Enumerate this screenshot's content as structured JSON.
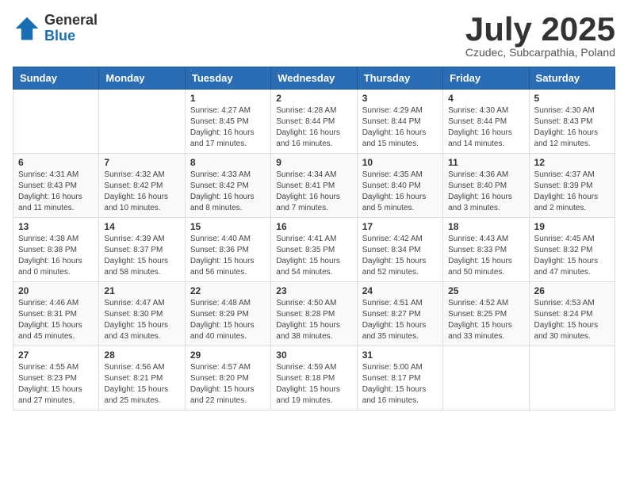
{
  "header": {
    "logo_general": "General",
    "logo_blue": "Blue",
    "month_title": "July 2025",
    "location": "Czudec, Subcarpathia, Poland"
  },
  "days_of_week": [
    "Sunday",
    "Monday",
    "Tuesday",
    "Wednesday",
    "Thursday",
    "Friday",
    "Saturday"
  ],
  "weeks": [
    [
      {
        "day": "",
        "info": ""
      },
      {
        "day": "",
        "info": ""
      },
      {
        "day": "1",
        "info": "Sunrise: 4:27 AM\nSunset: 8:45 PM\nDaylight: 16 hours and 17 minutes."
      },
      {
        "day": "2",
        "info": "Sunrise: 4:28 AM\nSunset: 8:44 PM\nDaylight: 16 hours and 16 minutes."
      },
      {
        "day": "3",
        "info": "Sunrise: 4:29 AM\nSunset: 8:44 PM\nDaylight: 16 hours and 15 minutes."
      },
      {
        "day": "4",
        "info": "Sunrise: 4:30 AM\nSunset: 8:44 PM\nDaylight: 16 hours and 14 minutes."
      },
      {
        "day": "5",
        "info": "Sunrise: 4:30 AM\nSunset: 8:43 PM\nDaylight: 16 hours and 12 minutes."
      }
    ],
    [
      {
        "day": "6",
        "info": "Sunrise: 4:31 AM\nSunset: 8:43 PM\nDaylight: 16 hours and 11 minutes."
      },
      {
        "day": "7",
        "info": "Sunrise: 4:32 AM\nSunset: 8:42 PM\nDaylight: 16 hours and 10 minutes."
      },
      {
        "day": "8",
        "info": "Sunrise: 4:33 AM\nSunset: 8:42 PM\nDaylight: 16 hours and 8 minutes."
      },
      {
        "day": "9",
        "info": "Sunrise: 4:34 AM\nSunset: 8:41 PM\nDaylight: 16 hours and 7 minutes."
      },
      {
        "day": "10",
        "info": "Sunrise: 4:35 AM\nSunset: 8:40 PM\nDaylight: 16 hours and 5 minutes."
      },
      {
        "day": "11",
        "info": "Sunrise: 4:36 AM\nSunset: 8:40 PM\nDaylight: 16 hours and 3 minutes."
      },
      {
        "day": "12",
        "info": "Sunrise: 4:37 AM\nSunset: 8:39 PM\nDaylight: 16 hours and 2 minutes."
      }
    ],
    [
      {
        "day": "13",
        "info": "Sunrise: 4:38 AM\nSunset: 8:38 PM\nDaylight: 16 hours and 0 minutes."
      },
      {
        "day": "14",
        "info": "Sunrise: 4:39 AM\nSunset: 8:37 PM\nDaylight: 15 hours and 58 minutes."
      },
      {
        "day": "15",
        "info": "Sunrise: 4:40 AM\nSunset: 8:36 PM\nDaylight: 15 hours and 56 minutes."
      },
      {
        "day": "16",
        "info": "Sunrise: 4:41 AM\nSunset: 8:35 PM\nDaylight: 15 hours and 54 minutes."
      },
      {
        "day": "17",
        "info": "Sunrise: 4:42 AM\nSunset: 8:34 PM\nDaylight: 15 hours and 52 minutes."
      },
      {
        "day": "18",
        "info": "Sunrise: 4:43 AM\nSunset: 8:33 PM\nDaylight: 15 hours and 50 minutes."
      },
      {
        "day": "19",
        "info": "Sunrise: 4:45 AM\nSunset: 8:32 PM\nDaylight: 15 hours and 47 minutes."
      }
    ],
    [
      {
        "day": "20",
        "info": "Sunrise: 4:46 AM\nSunset: 8:31 PM\nDaylight: 15 hours and 45 minutes."
      },
      {
        "day": "21",
        "info": "Sunrise: 4:47 AM\nSunset: 8:30 PM\nDaylight: 15 hours and 43 minutes."
      },
      {
        "day": "22",
        "info": "Sunrise: 4:48 AM\nSunset: 8:29 PM\nDaylight: 15 hours and 40 minutes."
      },
      {
        "day": "23",
        "info": "Sunrise: 4:50 AM\nSunset: 8:28 PM\nDaylight: 15 hours and 38 minutes."
      },
      {
        "day": "24",
        "info": "Sunrise: 4:51 AM\nSunset: 8:27 PM\nDaylight: 15 hours and 35 minutes."
      },
      {
        "day": "25",
        "info": "Sunrise: 4:52 AM\nSunset: 8:25 PM\nDaylight: 15 hours and 33 minutes."
      },
      {
        "day": "26",
        "info": "Sunrise: 4:53 AM\nSunset: 8:24 PM\nDaylight: 15 hours and 30 minutes."
      }
    ],
    [
      {
        "day": "27",
        "info": "Sunrise: 4:55 AM\nSunset: 8:23 PM\nDaylight: 15 hours and 27 minutes."
      },
      {
        "day": "28",
        "info": "Sunrise: 4:56 AM\nSunset: 8:21 PM\nDaylight: 15 hours and 25 minutes."
      },
      {
        "day": "29",
        "info": "Sunrise: 4:57 AM\nSunset: 8:20 PM\nDaylight: 15 hours and 22 minutes."
      },
      {
        "day": "30",
        "info": "Sunrise: 4:59 AM\nSunset: 8:18 PM\nDaylight: 15 hours and 19 minutes."
      },
      {
        "day": "31",
        "info": "Sunrise: 5:00 AM\nSunset: 8:17 PM\nDaylight: 15 hours and 16 minutes."
      },
      {
        "day": "",
        "info": ""
      },
      {
        "day": "",
        "info": ""
      }
    ]
  ]
}
